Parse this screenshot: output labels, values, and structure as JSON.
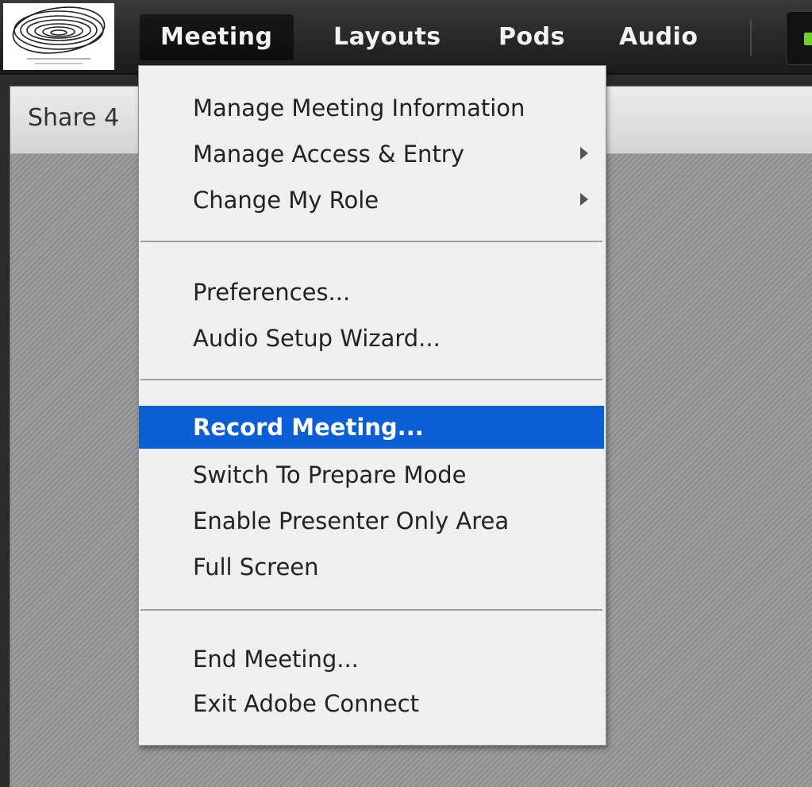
{
  "menubar": {
    "menus": [
      {
        "label": "Meeting",
        "open": true
      },
      {
        "label": "Layouts"
      },
      {
        "label": "Pods"
      },
      {
        "label": "Audio"
      }
    ],
    "status_color": "#6fd02a"
  },
  "pod": {
    "title": "Share 4"
  },
  "dropdown": {
    "highlight_color": "#0b5fd6",
    "items": [
      {
        "label": "Manage Meeting Information",
        "submenu": false
      },
      {
        "label": "Manage Access & Entry",
        "submenu": true
      },
      {
        "label": "Change My Role",
        "submenu": true
      },
      {
        "label": "Preferences..."
      },
      {
        "label": "Audio Setup Wizard..."
      },
      {
        "label": "Record Meeting...",
        "highlighted": true
      },
      {
        "label": "Switch To Prepare Mode"
      },
      {
        "label": "Enable Presenter Only Area"
      },
      {
        "label": "Full Screen"
      },
      {
        "label": "End Meeting..."
      },
      {
        "label": "Exit Adobe Connect"
      }
    ]
  }
}
